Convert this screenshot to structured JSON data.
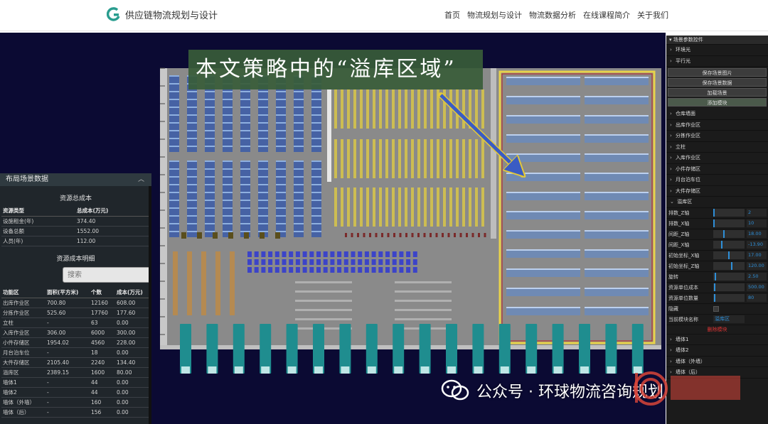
{
  "header": {
    "brand_name": "供应链物流规划与设计",
    "nav": [
      "首页",
      "物流规划与设计",
      "物流数据分析",
      "在线课程简介",
      "关于我们"
    ]
  },
  "annotation": {
    "text": "本文策略中的“溢库区域”"
  },
  "left_panel": {
    "title": "布局场景数据",
    "toggle": "︿",
    "total_cost": {
      "title": "资源总成本",
      "headers": [
        "资源类型",
        "总成本(万元)"
      ],
      "rows": [
        [
          "设施租金(年)",
          "374.40"
        ],
        [
          "设备总额",
          "1552.00"
        ],
        [
          "人员(年)",
          "112.00"
        ]
      ]
    },
    "detail": {
      "title": "资源成本明细",
      "search_placeholder": "搜索",
      "headers": [
        "功能区",
        "面积(平方米)",
        "个数",
        "成本(万元)"
      ],
      "rows": [
        [
          "出库作业区",
          "700.80",
          "12160",
          "608.00"
        ],
        [
          "分拣作业区",
          "525.60",
          "17760",
          "177.60"
        ],
        [
          "立柱",
          "-",
          "63",
          "0.00"
        ],
        [
          "入库作业区",
          "306.00",
          "6000",
          "300.00"
        ],
        [
          "小件存储区",
          "1954.02",
          "4560",
          "228.00"
        ],
        [
          "月台泊车位",
          "-",
          "18",
          "0.00"
        ],
        [
          "大件存储区",
          "2105.40",
          "2240",
          "134.40"
        ],
        [
          "溢库区",
          "2389.15",
          "1600",
          "80.00"
        ],
        [
          "墙体1",
          "-",
          "44",
          "0.00"
        ],
        [
          "墙体2",
          "-",
          "44",
          "0.00"
        ],
        [
          "墙体（外墙）",
          "-",
          "160",
          "0.00"
        ],
        [
          "墙体（后）",
          "-",
          "156",
          "0.00"
        ]
      ]
    }
  },
  "right_panel": {
    "title": "▾ 场景参数控件",
    "top_items": [
      "环境光",
      "平行光"
    ],
    "buttons": [
      "保存场景图片",
      "保存场景数据",
      "加载场景",
      "添加模块"
    ],
    "zone_items": [
      "仓库墙面",
      "出库作业区",
      "分拣作业区",
      "立柱",
      "入库作业区",
      "小件存储区",
      "月台泊车位",
      "大件存储区"
    ],
    "open_item": "溢库区",
    "params": [
      {
        "label": "排数_Z轴",
        "value": "2",
        "pos": 0.0
      },
      {
        "label": "排数_X轴",
        "value": "10",
        "pos": 0.0
      },
      {
        "label": "间距_Z轴",
        "value": "18.00",
        "pos": 0.33
      },
      {
        "label": "间距_X轴",
        "value": "-13.90",
        "pos": 0.25
      },
      {
        "label": "初始坐标_X轴",
        "value": "17.00",
        "pos": 0.5
      },
      {
        "label": "初始坐标_Z轴",
        "value": "120.00",
        "pos": 0.6
      },
      {
        "label": "旋转",
        "value": "2.50",
        "pos": 0.05
      },
      {
        "label": "资源单位成本",
        "value": "500.00",
        "pos": 0.03
      },
      {
        "label": "资源单位数量",
        "value": "80",
        "pos": 0.03
      }
    ],
    "hidden_label": "隐藏",
    "name_label": "当前模块名称",
    "name_value": "溢库区",
    "delete_label": "删除模块",
    "bottom_items": [
      "墙体1",
      "墙体2",
      "墙体（外墙）",
      "墙体（后）"
    ]
  },
  "watermark": {
    "text": "公众号 · 环球物流咨询规划"
  },
  "colors": {
    "scene_bg": "#0b0a33",
    "floor": "#8a8a8a",
    "rack_blue": "#3a5aa8",
    "rack_yellow": "#d8c548",
    "truck_teal": "#1f8d8f",
    "highlight": "#e8d34a",
    "accent": "#2e8fd8"
  }
}
